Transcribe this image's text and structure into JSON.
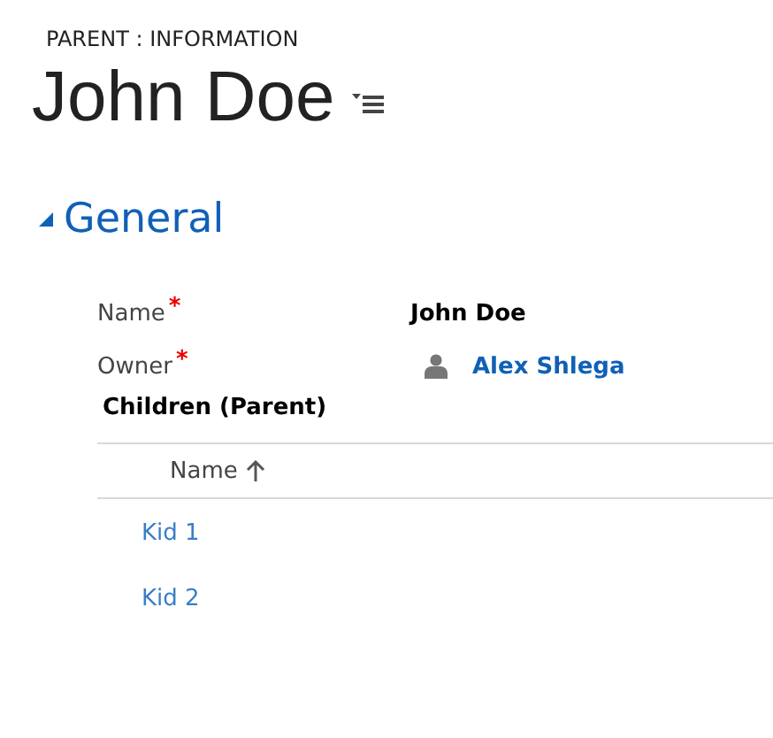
{
  "header": {
    "entity_label": "PARENT : INFORMATION",
    "title": "John Doe"
  },
  "section": {
    "title": "General",
    "expanded": true,
    "fields": [
      {
        "kind": "text",
        "label": "Name",
        "required_mark": "*",
        "value": "John Doe"
      },
      {
        "kind": "lookup",
        "label": "Owner",
        "required_mark": "*",
        "value": "Alex Shlega"
      }
    ],
    "subgrid": {
      "title": "Children (Parent)",
      "columns": [
        {
          "label": "Name",
          "sort_ascending": true
        }
      ],
      "rows": [
        {
          "name": "Kid 1"
        },
        {
          "name": "Kid 2"
        }
      ]
    }
  }
}
